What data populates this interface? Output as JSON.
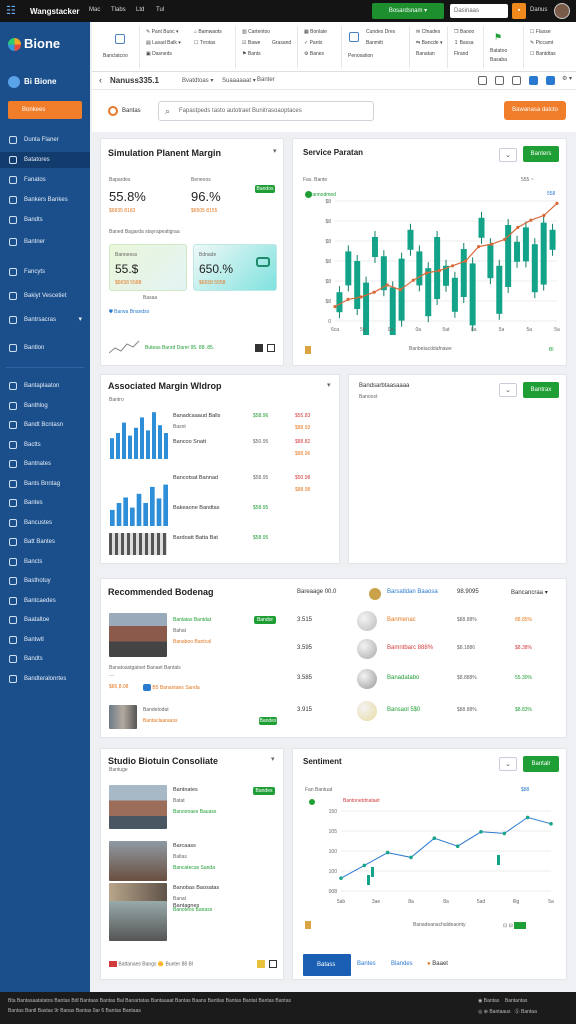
{
  "topbar": {
    "app_title": "Wangstacker",
    "menu": [
      "Mac",
      "Tlabs",
      "Ltd",
      "Tul"
    ],
    "green_button": "Bosardsnam",
    "search_placeholder": "Dasinaas",
    "user": "Danus"
  },
  "sidebar": {
    "brand": "Bione",
    "section": "Bi Bione",
    "cta": "Bonkees",
    "items": [
      {
        "label": "Dunta Flaner",
        "active": false
      },
      {
        "label": "Batatores",
        "active": true
      },
      {
        "label": "Fanatos",
        "active": false
      },
      {
        "label": "Bankers Bankes",
        "active": false
      },
      {
        "label": "Bandts",
        "active": false
      },
      {
        "label": "Bantner",
        "active": false
      },
      {
        "label": "Fancyts",
        "active": false
      },
      {
        "label": "Bakiyt Vescetiet",
        "active": false
      },
      {
        "label": "Bantrsacras",
        "active": false
      },
      {
        "label": "Bantlon",
        "active": false
      }
    ],
    "items2": [
      {
        "label": "Bantaplaaton"
      },
      {
        "label": "Banthlog"
      },
      {
        "label": "Bandt Bcntasn"
      },
      {
        "label": "Bactts"
      },
      {
        "label": "Bantnates"
      },
      {
        "label": "Bants Bnntag"
      },
      {
        "label": "Bantes"
      },
      {
        "label": "Bancustes"
      },
      {
        "label": "Batt Bantes"
      },
      {
        "label": "Bancts"
      },
      {
        "label": "Basthotuy"
      },
      {
        "label": "Bantcaedes"
      },
      {
        "label": "Baataltoe"
      },
      {
        "label": "Bantwtl"
      },
      {
        "label": "Bandts"
      },
      {
        "label": "Bandteralonrtes"
      }
    ]
  },
  "ribbon": {
    "groups": [
      {
        "label": "Banclatcoo"
      },
      {
        "items": [
          "Pant Buoc",
          "Laxad Balk",
          "Dasneds",
          "Bamwaots",
          "Trrotas"
        ]
      },
      {
        "items": [
          "Cartentoo",
          "Bawe",
          "Bants",
          "Grasand"
        ]
      },
      {
        "items": [
          "Bonlate",
          "Pants",
          "Banes"
        ]
      },
      {
        "items": [
          "Cundes Dres",
          "Banmitt",
          "Penosation"
        ]
      },
      {
        "items": [
          "Cfnades",
          "Bancde",
          "Banatan"
        ]
      },
      {
        "items": [
          "Baooo",
          "Bassa",
          "Flrand"
        ]
      },
      {
        "items": [
          "Batatoo",
          "Basaba"
        ]
      },
      {
        "items": [
          "Flasse",
          "Piccamt",
          "Bantdtas"
        ]
      }
    ]
  },
  "breadcrumb": {
    "title": "Nanuss335.1",
    "items": [
      "Bvatdtoas",
      "Suaaaaaat",
      "Banter"
    ]
  },
  "search": {
    "label": "Bantas",
    "placeholder": "Fapastpeds tasto autotraet Bunitrasoaoptaces",
    "button": "Bawanasa dalcto"
  },
  "card_simulation": {
    "title": "Simulation Planent Margin",
    "metric1_label": "Bapardes",
    "metric1_value": "55.8%",
    "metric1_sub": "$6835 8183",
    "metric2_label": "Beneoos",
    "metric2_value": "96.%",
    "metric2_sub": "$6505 8155",
    "metric2_badge": "Bandos",
    "subtitle": "Baned Bagarda stayrapeatigraa",
    "tile1_label": "Banneess",
    "tile1_value": "55.$",
    "tile1_sub": "$6658 5588",
    "tile2_label": "Bdnade",
    "tile2_value": "650.%",
    "tile2_sub": "$6658 5558",
    "link": "Barwa Bnandso",
    "footer_left": "Basaa",
    "footer": "Buteas Banrd Darer 95. 88. 85."
  },
  "card_service": {
    "title": "Service Paratan",
    "button": "Banters",
    "sub": "Fas. Bante",
    "legend": "Bannodmed",
    "right_label": "555 ~",
    "right_val": "558",
    "xlabels": [
      "6ca",
      "5g",
      "0a",
      "0a",
      "5at",
      "8a",
      "5a",
      "5a",
      "5a"
    ],
    "xtitle": "Banbetacddafnawe",
    "footer_val": "Bl"
  },
  "card_associated": {
    "title": "Associated Margin Wldrop",
    "sub": "Bantro",
    "rows": [
      {
        "name": "Banadcaaaud Balls",
        "sub": "Basnt",
        "v1": "$58.96",
        "v2": "$55.83",
        "v3": "$88.93"
      },
      {
        "name": "Bancoo Snatt",
        "sub": "",
        "v1": "$50.95",
        "v2": "$88.82",
        "v3": "$88.96"
      },
      {
        "name": "Bancotsat Bannad",
        "sub": "",
        "v1": "$58.95",
        "v2": "$50.98",
        "v3": "$88.98"
      },
      {
        "name": "Bakeaone Bandtas",
        "sub": "",
        "v1": "$58.95",
        "v2": "",
        "v3": ""
      },
      {
        "name": "Bardoatt Batta Bat",
        "sub": "",
        "v1": "$58.95",
        "v2": "",
        "v3": ""
      }
    ]
  },
  "card_bando": {
    "title": "Bandsarbtaasaaaa",
    "sub": "Banoost",
    "button": "Bantrax"
  },
  "card_recommended": {
    "title": "Recommended Bodenag",
    "rows": [
      {
        "title": "Banlatas Bantdat",
        "sub": "Bahat",
        "extra": "Banaboo Bantcal",
        "badge": "Bandor"
      },
      {
        "title": "Banatoastgatoet Banaet Bantals",
        "sub": "$86,8.08",
        "extra": "B5 Banantaes Sanda",
        "badge": ""
      },
      {
        "title": "Bandetodat",
        "sub": "Bantaclaaraass",
        "extra": "",
        "badge": "Bandes"
      }
    ]
  },
  "card_exchange": {
    "header_c1": "Bareaage 00.0",
    "header_c2": "Barsatldan Baaosa",
    "header_c3": "98.9095",
    "header_c4": "Bancancraa ▾",
    "rows": [
      {
        "left": "3.515",
        "name": "Banmenac",
        "c2": "$88.88%",
        "c3": "88.85%",
        "c4_color": "orange"
      },
      {
        "left": "3.595",
        "name": "Bamntbarc 888%",
        "c2": "$8.1886",
        "c3": "$8.38%",
        "c4_color": "red"
      },
      {
        "left": "3.585",
        "name": "Banadatabo",
        "c2": "$8.888%",
        "c3": "55.30%",
        "c4_color": "green"
      },
      {
        "left": "3.915",
        "name": "Bansaol 5$0",
        "c2": "$88.88%",
        "c3": "$8.83%",
        "c4_color": "green"
      }
    ]
  },
  "card_studio": {
    "title": "Studio Biotuin Consoliate",
    "sub": "Bantuge",
    "rows": [
      {
        "title": "Bantnates",
        "sub": "Batat",
        "extra": "Banoonaes Bauass",
        "badge": "Bandes"
      },
      {
        "title": "Barcaass",
        "sub": "Baltas",
        "extra": "Bancatecas Sanda",
        "badge": ""
      },
      {
        "title": "Banobas Baosatas",
        "sub": "Banat",
        "extra": "Banoteos Banass",
        "badge": ""
      },
      {
        "title": "Bantagnes",
        "sub": "",
        "extra": "",
        "badge": ""
      }
    ],
    "footer": "Battanaes Bangs 🌼 Bunter 88 Bl"
  },
  "card_sentiment": {
    "title": "Sentiment",
    "button": "Bantalr",
    "sub": "Fan Bantuat",
    "legend": "Bantonetdnataet",
    "right_val": "$88",
    "ylabels": [
      "150",
      "105",
      "100",
      "100",
      "008"
    ],
    "xlabels": [
      "5ab",
      "3ae",
      "8a",
      "8a",
      "5ad",
      "6lg",
      "5a"
    ],
    "xtitle": "Banadeanachaldeaonty",
    "tabs": [
      "Batass",
      "Bantes",
      "Blandes",
      "Baaet"
    ]
  },
  "chart_data": [
    {
      "type": "bar",
      "title": "Service Paratan",
      "xlabel": "",
      "ylabel": "",
      "yticks": [
        "$8",
        "$8",
        "$8",
        "$8",
        "$8",
        "$8",
        "0"
      ],
      "series": [
        {
          "name": "candles",
          "values": [
            1.2,
            2.9,
            2.5,
            1.6,
            3.5,
            2.7,
            1.4,
            2.6,
            3.8,
            2.9,
            2.2,
            3.5,
            2.3,
            1.8,
            3.0,
            2.4,
            4.3,
            3.2,
            2.3,
            4.0,
            3.3,
            3.9,
            3.2,
            4.1,
            3.8
          ]
        },
        {
          "name": "trend",
          "values": [
            0.6,
            0.9,
            1.0,
            1.2,
            1.5,
            1.3,
            1.7,
            2.0,
            2.1,
            2.3,
            2.5,
            3.1,
            3.2,
            3.4,
            3.9,
            4.2,
            4.4,
            4.9
          ]
        }
      ]
    },
    {
      "type": "line",
      "title": "Sentiment",
      "yticks": [
        "150",
        "105",
        "100",
        "100",
        "008"
      ],
      "series": [
        {
          "name": "line",
          "values": [
            0.8,
            1.6,
            2.4,
            2.1,
            3.3,
            2.8,
            3.7,
            3.6,
            4.6,
            4.2
          ]
        }
      ]
    }
  ]
}
